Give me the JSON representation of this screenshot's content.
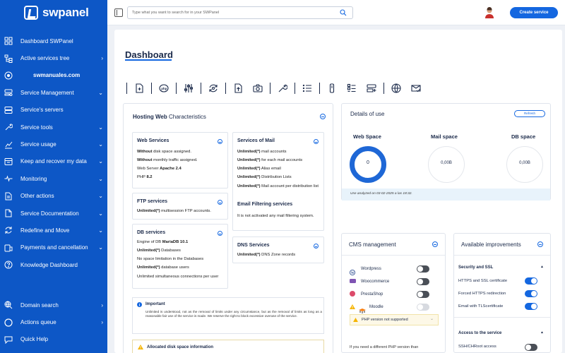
{
  "brand": {
    "name": "swpanel"
  },
  "sidebar": {
    "items": [
      {
        "label": "Dashboard SWPanel",
        "icon": "grid-icon",
        "arrow": ""
      },
      {
        "label": "Active services tree",
        "icon": "tree-icon",
        "arrow": "›"
      },
      {
        "label": "swmanuales.com",
        "icon": "",
        "arrow": "",
        "sub": true
      },
      {
        "label": "Service Management",
        "icon": "server-gear-icon",
        "arrow": "⌄"
      },
      {
        "label": "Service's servers",
        "icon": "server-icon",
        "arrow": ""
      },
      {
        "label": "Service tools",
        "icon": "wrench-icon",
        "arrow": "⌄"
      },
      {
        "label": "Service usage",
        "icon": "chart-icon",
        "arrow": "⌄"
      },
      {
        "label": "Keep and recover my data",
        "icon": "archive-icon",
        "arrow": "⌄"
      },
      {
        "label": "Monitoring",
        "icon": "pulse-icon",
        "arrow": "⌄"
      },
      {
        "label": "Other actions",
        "icon": "document-icon",
        "arrow": "⌄"
      },
      {
        "label": "Service Documentation",
        "icon": "doc-icon",
        "arrow": "⌄"
      },
      {
        "label": "Redefine and Move",
        "icon": "refresh-icon",
        "arrow": "⌄"
      },
      {
        "label": "Payments and cancellation",
        "icon": "payment-icon",
        "arrow": "⌄"
      },
      {
        "label": "Knowledge Dashboard",
        "icon": "question-icon",
        "arrow": ""
      }
    ],
    "bottom": [
      {
        "label": "Domain search",
        "icon": "globe-search-icon",
        "arrow": "›"
      },
      {
        "label": "Actions queue",
        "icon": "circle-icon",
        "arrow": "›"
      },
      {
        "label": "Quick Help",
        "icon": "help-chat-icon",
        "arrow": ""
      }
    ]
  },
  "topbar": {
    "search_placeholder": "Type what you want to search for in your SWPanel",
    "create_label": "Create service"
  },
  "dashboard": {
    "title": "Dashboard",
    "hosting": {
      "title_bold": "Hosting Web",
      "title_rest": " Characteristics",
      "web": {
        "title": "Web Services",
        "l1b": "Without",
        "l1": " disk space assigned.",
        "l2b": "Without",
        "l2": " monthly traffic assigned.",
        "l3": "Web Server ",
        "l3b": "Apache 2.4",
        "l4": "PHP ",
        "l4b": "8.2"
      },
      "mail": {
        "title": "Services of Mail",
        "l1b": "Unlimited(*)",
        "l1": " mail accounts",
        "l2b": "Unlimited(*)",
        "l2": " for each mail accounts",
        "l3b": "Unlimited(*)",
        "l3": " Alias email",
        "l4b": "Unlimited(*)",
        "l4": " Distribution Lists",
        "l5b": "Unlimited(*)",
        "l5": " Mail account per distribution list"
      },
      "filter": {
        "title": "Email Filtering services",
        "text": "It is not activated any mail filtering system."
      },
      "ftp": {
        "title": "FTP services",
        "l1b": "Unlimited(*)",
        "l1": " multisession FTP accounts."
      },
      "db": {
        "title": "DB services",
        "l1": "Engine of DB ",
        "l1b": "MariaDB 10.1",
        "l2b": "Unlimited(*)",
        "l2": " Databases",
        "l3": "No space limitation in the Databases",
        "l4b": "Unlimited(*)",
        "l4": " database users",
        "l5": "Unlimited simultaneous connections per user"
      },
      "dns": {
        "title": "DNS Services",
        "l1b": "Unlimited(*)",
        "l1": " DNS Zone records"
      },
      "important": {
        "title": "Important",
        "text": "Unlimited is understood, not as the removal of limits under any circumstance, but as the removal of limits as long as a reasonable fair use of the service is made. We reserve the right to block excessive overuse of the service."
      },
      "allocated": {
        "title": "Allocated disk space information"
      }
    },
    "usage": {
      "title": "Details of use",
      "refresh": "Refresh",
      "web_label": "Web Space",
      "web_value": "0",
      "mail_label": "Mail space",
      "mail_value": "0,00B",
      "db_label": "DB space",
      "db_value": "0,00B",
      "note": "Use analyzed on 03-02-2025 a las 18:32."
    },
    "cms": {
      "title": "CMS management",
      "items": [
        {
          "label": "Wordpress",
          "state": "off"
        },
        {
          "label": "Woocommerce",
          "state": "off"
        },
        {
          "label": "PrestaShop",
          "state": "off"
        },
        {
          "label": "Moodle",
          "state": "disabled"
        }
      ],
      "php_warning": "PHP version not supported",
      "footer": "If you need a different PHP version than"
    },
    "improvements": {
      "title": "Available improvements",
      "security_title": "Security and SSL",
      "security_items": [
        {
          "label": "HTTPS and SSL certificate",
          "state": "on"
        },
        {
          "label": "Forced HTTPS redirection",
          "state": "on"
        },
        {
          "label": "Email with TLScertificate",
          "state": "on"
        }
      ],
      "access_title": "Access to the service",
      "access_items": [
        {
          "label": "SSH/CHRoot access",
          "state": "off"
        }
      ]
    }
  }
}
